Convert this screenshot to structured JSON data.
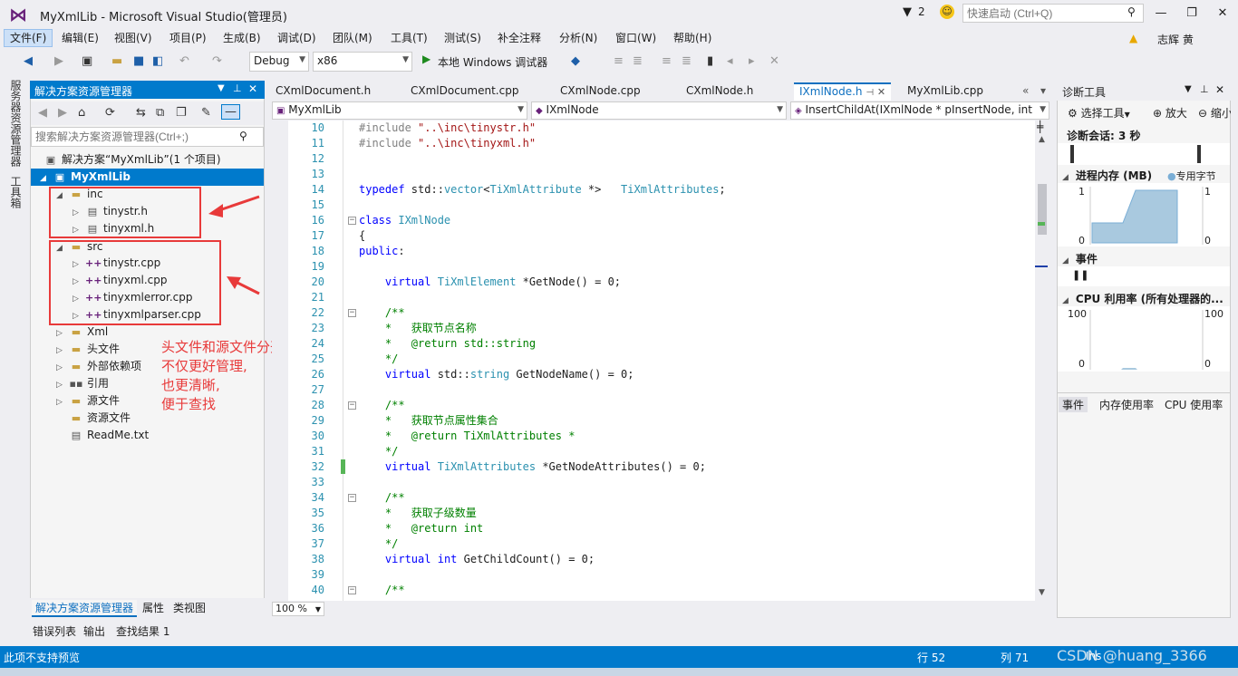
{
  "window": {
    "title": "MyXmlLib - Microsoft Visual Studio(管理员)",
    "notification_count": "2",
    "quick_launch_placeholder": "快速启动 (Ctrl+Q)"
  },
  "menu": {
    "items": [
      {
        "label": "文件(F)"
      },
      {
        "label": "编辑(E)"
      },
      {
        "label": "视图(V)"
      },
      {
        "label": "项目(P)"
      },
      {
        "label": "生成(B)"
      },
      {
        "label": "调试(D)"
      },
      {
        "label": "团队(M)"
      },
      {
        "label": "工具(T)"
      },
      {
        "label": "测试(S)"
      },
      {
        "label": "补全注释"
      },
      {
        "label": "分析(N)"
      },
      {
        "label": "窗口(W)"
      },
      {
        "label": "帮助(H)"
      }
    ],
    "user": "志辉 黄"
  },
  "toolbar": {
    "config": "Debug",
    "platform": "x86",
    "run_label": "本地 Windows 调试器"
  },
  "left_strip": {
    "tab1": "服务器资源管理器",
    "tab2": "工具箱"
  },
  "solution_explorer": {
    "title": "解决方案资源管理器",
    "search_placeholder": "搜索解决方案资源管理器(Ctrl+;)",
    "tree": [
      {
        "label": "解决方案“MyXmlLib”(1 个项目)"
      },
      {
        "label": "MyXmlLib"
      },
      {
        "label": "inc"
      },
      {
        "label": "tinystr.h"
      },
      {
        "label": "tinyxml.h"
      },
      {
        "label": "src"
      },
      {
        "label": "tinystr.cpp"
      },
      {
        "label": "tinyxml.cpp"
      },
      {
        "label": "tinyxmlerror.cpp"
      },
      {
        "label": "tinyxmlparser.cpp"
      },
      {
        "label": "Xml"
      },
      {
        "label": "头文件"
      },
      {
        "label": "外部依赖项"
      },
      {
        "label": "引用"
      },
      {
        "label": "源文件"
      },
      {
        "label": "资源文件"
      },
      {
        "label": "ReadMe.txt"
      }
    ],
    "annotation": [
      "头文件和源文件分开放,",
      "不仅更好管理,",
      "也更清晰,",
      "便于查找"
    ],
    "bottom_tabs": [
      "解决方案资源管理器",
      "属性",
      "类视图"
    ]
  },
  "output_tabs": [
    "错误列表",
    "输出",
    "查找结果 1"
  ],
  "editor": {
    "tabs": [
      "CXmlDocument.h",
      "CXmlDocument.cpp",
      "CXmlNode.cpp",
      "CXmlNode.h",
      "IXmlNode.h",
      "MyXmlLib.cpp"
    ],
    "nav": {
      "project": "MyXmlLib",
      "scope": "IXmlNode",
      "member": "InsertChildAt(IXmlNode * pInsertNode, int"
    },
    "zoom": "100 %",
    "lines": [
      {
        "n": "10",
        "text": "#include \"..\\inc\\tinystr.h\""
      },
      {
        "n": "11",
        "text": "#include \"..\\inc\\tinyxml.h\""
      },
      {
        "n": "12",
        "text": ""
      },
      {
        "n": "13",
        "text": ""
      },
      {
        "n": "14",
        "text": "typedef std::vector<TiXmlAttribute *>   TiXmlAttributes;"
      },
      {
        "n": "15",
        "text": ""
      },
      {
        "n": "16",
        "text": "class IXmlNode"
      },
      {
        "n": "17",
        "text": "{"
      },
      {
        "n": "18",
        "text": "public:"
      },
      {
        "n": "19",
        "text": ""
      },
      {
        "n": "20",
        "text": "    virtual TiXmlElement *GetNode() = 0;"
      },
      {
        "n": "21",
        "text": ""
      },
      {
        "n": "22",
        "text": "    /**"
      },
      {
        "n": "23",
        "text": "    *   获取节点名称"
      },
      {
        "n": "24",
        "text": "    *   @return std::string"
      },
      {
        "n": "25",
        "text": "    */"
      },
      {
        "n": "26",
        "text": "    virtual std::string GetNodeName() = 0;"
      },
      {
        "n": "27",
        "text": ""
      },
      {
        "n": "28",
        "text": "    /**"
      },
      {
        "n": "29",
        "text": "    *   获取节点属性集合"
      },
      {
        "n": "30",
        "text": "    *   @return TiXmlAttributes *"
      },
      {
        "n": "31",
        "text": "    */"
      },
      {
        "n": "32",
        "text": "    virtual TiXmlAttributes *GetNodeAttributes() = 0;"
      },
      {
        "n": "33",
        "text": ""
      },
      {
        "n": "34",
        "text": "    /**"
      },
      {
        "n": "35",
        "text": "    *   获取子级数量"
      },
      {
        "n": "36",
        "text": "    *   @return int"
      },
      {
        "n": "37",
        "text": "    */"
      },
      {
        "n": "38",
        "text": "    virtual int GetChildCount() = 0;"
      },
      {
        "n": "39",
        "text": ""
      },
      {
        "n": "40",
        "text": "    /**"
      }
    ]
  },
  "diagnostics": {
    "title": "诊断工具",
    "select_tool": "选择工具",
    "zoom_in": "放大",
    "zoom_out": "缩小",
    "session": "诊断会话: 3 秒",
    "memory": {
      "title": "进程内存 (MB)",
      "legend": "专用字节",
      "max": "1",
      "min": "0",
      "max_r": "1",
      "min_r": "0"
    },
    "events": {
      "title": "事件"
    },
    "cpu": {
      "title": "CPU 利用率 (所有处理器的...",
      "max": "100",
      "min": "0",
      "max_r": "100",
      "min_r": "0"
    },
    "bottom_tabs": [
      "事件",
      "内存使用率",
      "CPU 使用率"
    ]
  },
  "status": {
    "message": "此项不支持预览",
    "line": "行 52",
    "col": "列 71",
    "watermark": "CSDN @huang_3366",
    "mode": "Ins"
  }
}
